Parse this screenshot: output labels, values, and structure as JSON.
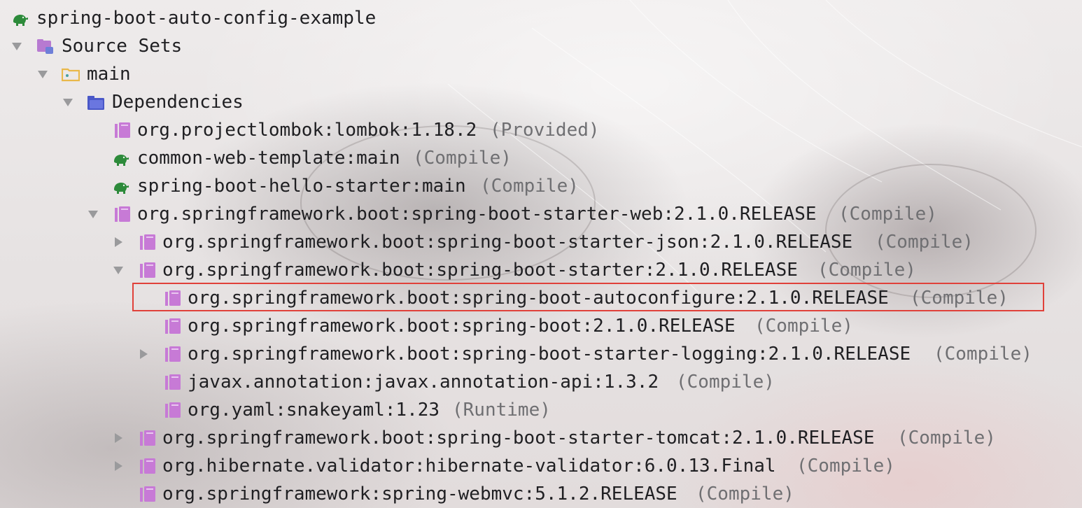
{
  "tree": {
    "root": {
      "label": "spring-boot-auto-config-example",
      "icon": "gradle-elephant-icon"
    },
    "source_sets": {
      "label": "Source Sets",
      "icon": "source-sets-icon"
    },
    "main": {
      "label": "main",
      "icon": "folder-icon"
    },
    "dependencies": {
      "label": "Dependencies",
      "icon": "dependencies-folder-icon"
    },
    "items": [
      {
        "label": "org.projectlombok:lombok:1.18.2",
        "scope": "(Provided)",
        "icon": "library-icon"
      },
      {
        "label": "common-web-template:main",
        "scope": "(Compile)",
        "icon": "gradle-elephant-icon"
      },
      {
        "label": "spring-boot-hello-starter:main",
        "scope": "(Compile)",
        "icon": "gradle-elephant-icon"
      },
      {
        "label": "org.springframework.boot:spring-boot-starter-web:2.1.0.RELEASE",
        "scope": "(Compile)",
        "icon": "library-icon",
        "expanded": true
      },
      {
        "label": "org.springframework.boot:spring-boot-starter-json:2.1.0.RELEASE",
        "scope": "(Compile)",
        "icon": "library-icon",
        "expanded": false
      },
      {
        "label": "org.springframework.boot:spring-boot-starter:2.1.0.RELEASE",
        "scope": "(Compile)",
        "icon": "library-icon",
        "expanded": true
      },
      {
        "label": "org.springframework.boot:spring-boot-autoconfigure:2.1.0.RELEASE",
        "scope": "(Compile)",
        "icon": "library-icon",
        "highlighted": true
      },
      {
        "label": "org.springframework.boot:spring-boot:2.1.0.RELEASE",
        "scope": "(Compile)",
        "icon": "library-icon"
      },
      {
        "label": "org.springframework.boot:spring-boot-starter-logging:2.1.0.RELEASE",
        "scope": "(Compile)",
        "icon": "library-icon",
        "expanded": false
      },
      {
        "label": "javax.annotation:javax.annotation-api:1.3.2",
        "scope": "(Compile)",
        "icon": "library-icon"
      },
      {
        "label": "org.yaml:snakeyaml:1.23",
        "scope": "(Runtime)",
        "icon": "library-icon"
      },
      {
        "label": "org.springframework.boot:spring-boot-starter-tomcat:2.1.0.RELEASE",
        "scope": "(Compile)",
        "icon": "library-icon",
        "expanded": false
      },
      {
        "label": "org.hibernate.validator:hibernate-validator:6.0.13.Final",
        "scope": "(Compile)",
        "icon": "library-icon",
        "expanded": false
      },
      {
        "label": "org.springframework:spring-webmvc:5.1.2.RELEASE",
        "scope": "(Compile)",
        "icon": "library-icon"
      }
    ]
  },
  "colors": {
    "library_icon": "#c77ad6",
    "gradle_icon": "#2d8a3a",
    "folder_icon": "#e9b84a",
    "dependencies_icon": "#4a58c8",
    "highlight_border": "#e0413a",
    "scope_text": "#6f6f72"
  }
}
